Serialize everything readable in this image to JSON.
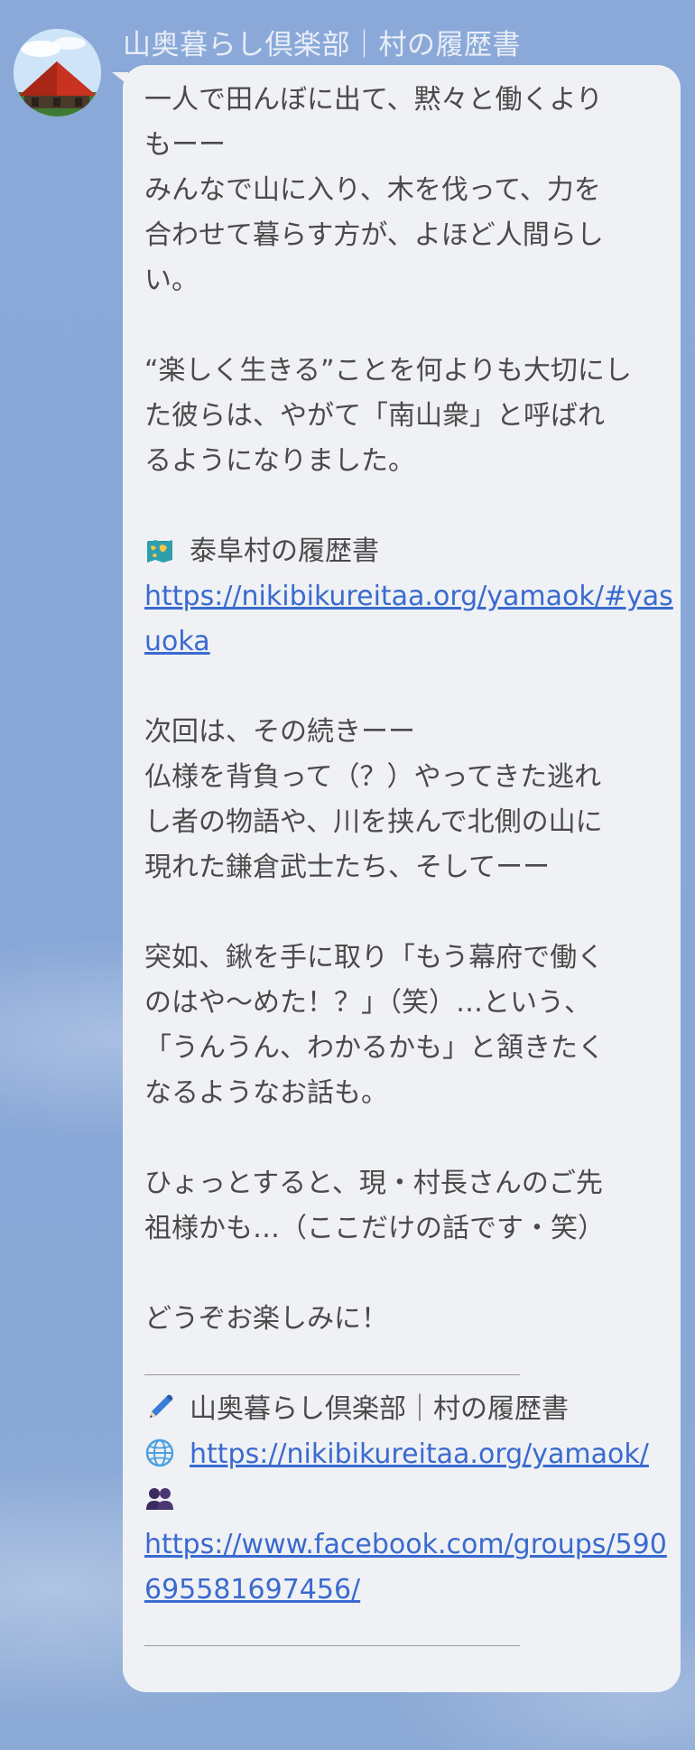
{
  "sender": {
    "name": "山奥暮らし倶楽部｜村の履歴書"
  },
  "message": {
    "p1_l1": "一人で田んぼに出て、黙々と働くより",
    "p1_l2": "もーー",
    "p1_l3": "みんなで山に入り、木を伐って、力を",
    "p1_l4": "合わせて暮らす方が、よほど人間らし",
    "p1_l5": "い。",
    "p2_l1": "“楽しく生きる”ことを何よりも大切にし",
    "p2_l2": "た彼らは、やがて「南山衆」と呼ばれ",
    "p2_l3": "るようになりました。",
    "map_label": "泰阜村の履歴書",
    "link1_l1": "https://nikibikureitaa.org/yamaok/#yas",
    "link1_l2": "uoka",
    "p3_l1": "次回は、その続きーー",
    "p3_l2": "仏様を背負って（？）やってきた逃れ",
    "p3_l3": "し者の物語や、川を挟んで北側の山に",
    "p3_l4": "現れた鎌倉武士たち、そしてーー",
    "p4_l1": "突如、鍬を手に取り「もう幕府で働く",
    "p4_l2": "のはや〜めた！？」（笑）…という、",
    "p4_l3": "「うんうん、わかるかも」と頷きたく",
    "p4_l4": "なるようなお話も。",
    "p5_l1": "ひょっとすると、現・村長さんのご先",
    "p5_l2": "祖様かも…（ここだけの話です・笑）",
    "p6_l1": "どうぞお楽しみに！",
    "sig_name": "山奥暮らし倶楽部｜村の履歴書",
    "sig_site": "https://nikibikureitaa.org/yamaok/",
    "sig_fb_l1": "https://www.facebook.com/groups/590",
    "sig_fb_l2": "695581697456/"
  },
  "icons": {
    "avatar": "red-roof-photo",
    "map": "world-map-icon",
    "pen": "pencil-icon",
    "globe": "globe-icon",
    "people": "busts-icon"
  },
  "colors": {
    "background": "#8aa8d8",
    "bubble": "#eff1f4",
    "text": "#4a4a4a",
    "link": "#3a6ad0",
    "name": "#e9eef7"
  }
}
